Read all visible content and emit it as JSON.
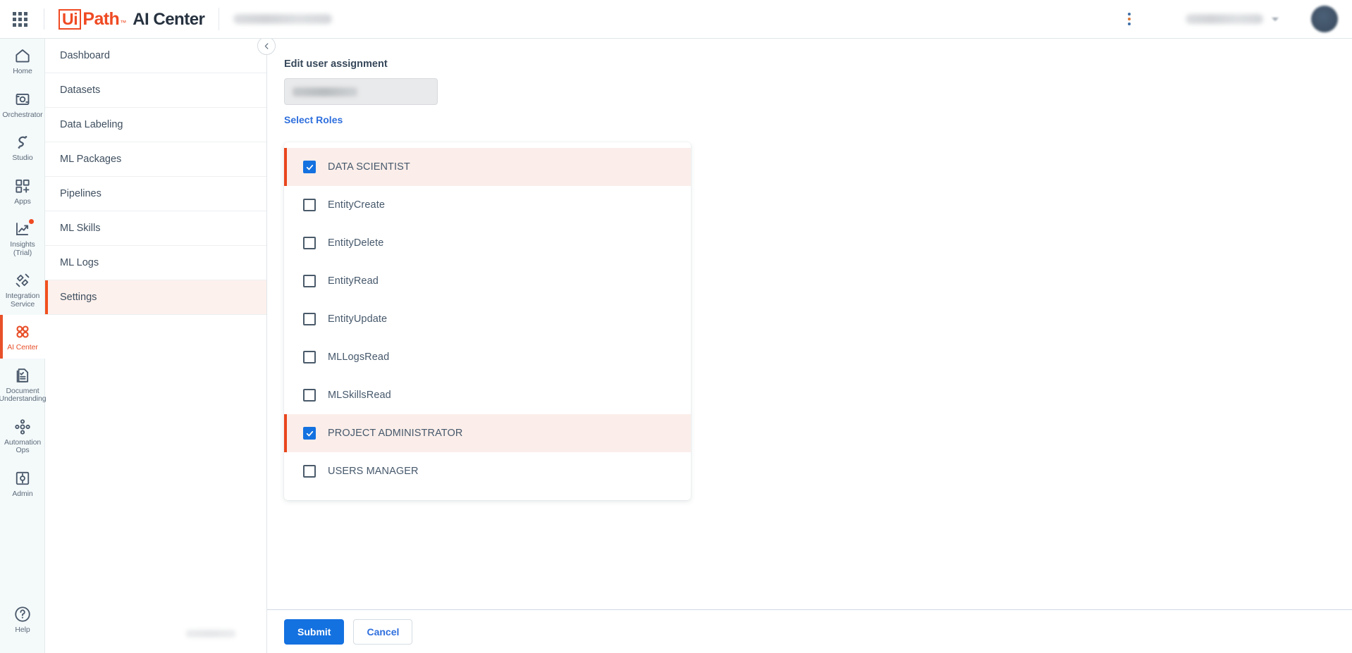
{
  "header": {
    "apps_launcher_icon": "grid-apps-icon",
    "logo_ui": "Ui",
    "logo_path": "Path",
    "logo_tm": "™",
    "product_name": "AI Center",
    "project_name_redacted": "",
    "kebab_icon": "more-vertical-icon",
    "tenant_name_redacted": "",
    "chevron_icon": "chevron-down-icon",
    "avatar_icon": "user-avatar"
  },
  "rail": {
    "items": [
      {
        "label": "Home",
        "icon": "home-icon",
        "active": false,
        "badge": false
      },
      {
        "label": "Orchestrator",
        "icon": "orchestrator-icon",
        "active": false,
        "badge": false
      },
      {
        "label": "Studio",
        "icon": "studio-icon",
        "active": false,
        "badge": false
      },
      {
        "label": "Apps",
        "icon": "apps-icon",
        "active": false,
        "badge": false
      },
      {
        "label": "Insights (Trial)",
        "icon": "insights-icon",
        "active": false,
        "badge": true
      },
      {
        "label": "Integration Service",
        "icon": "integration-service-icon",
        "active": false,
        "badge": false
      },
      {
        "label": "AI Center",
        "icon": "ai-center-icon",
        "active": true,
        "badge": false
      },
      {
        "label": "Document Understanding",
        "icon": "document-understanding-icon",
        "active": false,
        "badge": false
      },
      {
        "label": "Automation Ops",
        "icon": "automation-ops-icon",
        "active": false,
        "badge": false
      },
      {
        "label": "Admin",
        "icon": "admin-icon",
        "active": false,
        "badge": false
      }
    ],
    "help": {
      "label": "Help",
      "icon": "help-circle-icon"
    }
  },
  "subnav": {
    "items": [
      {
        "label": "Dashboard",
        "active": false
      },
      {
        "label": "Datasets",
        "active": false
      },
      {
        "label": "Data Labeling",
        "active": false
      },
      {
        "label": "ML Packages",
        "active": false
      },
      {
        "label": "Pipelines",
        "active": false
      },
      {
        "label": "ML Skills",
        "active": false
      },
      {
        "label": "ML Logs",
        "active": false
      },
      {
        "label": "Settings",
        "active": true
      }
    ],
    "collapse_icon": "chevron-left-icon"
  },
  "main": {
    "title": "Edit user assignment",
    "user_field": {
      "value_redacted": "",
      "disabled": true
    },
    "select_roles_label": "Select Roles",
    "roles": [
      {
        "label": "DATA SCIENTIST",
        "checked": true
      },
      {
        "label": "EntityCreate",
        "checked": false
      },
      {
        "label": "EntityDelete",
        "checked": false
      },
      {
        "label": "EntityRead",
        "checked": false
      },
      {
        "label": "EntityUpdate",
        "checked": false
      },
      {
        "label": "MLLogsRead",
        "checked": false
      },
      {
        "label": "MLSkillsRead",
        "checked": false
      },
      {
        "label": "PROJECT ADMINISTRATOR",
        "checked": true
      },
      {
        "label": "USERS MANAGER",
        "checked": false
      }
    ]
  },
  "footer": {
    "submit_label": "Submit",
    "cancel_label": "Cancel"
  },
  "colors": {
    "brand_orange": "#ef4a23",
    "active_orange": "#e8502a",
    "primary_blue": "#1471e0",
    "link_blue": "#2f6fdd",
    "selected_row_bg": "#fbeeea",
    "rail_bg": "#f4f9fa",
    "text_dark": "#37485a"
  }
}
